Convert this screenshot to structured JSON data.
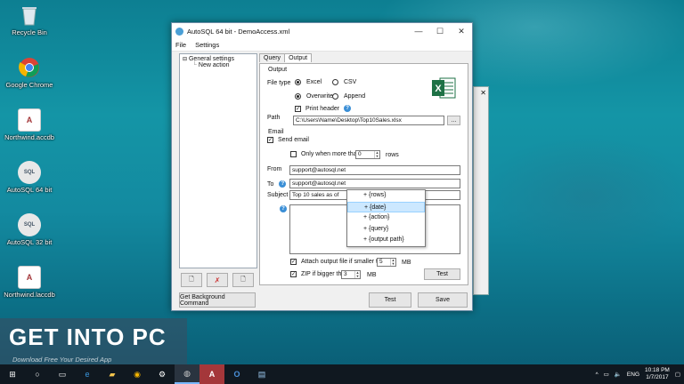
{
  "desktop": {
    "icons": [
      {
        "label": "Recycle Bin",
        "icon": "recycle-bin-icon"
      },
      {
        "label": "Google Chrome",
        "icon": "chrome-icon"
      },
      {
        "label": "Northwind.accdb",
        "icon": "access-file-icon"
      },
      {
        "label": "AutoSQL 64 bit",
        "icon": "autosql-icon"
      },
      {
        "label": "AutoSQL 32 bit",
        "icon": "autosql-icon"
      },
      {
        "label": "Northwind.laccdb",
        "icon": "access-lock-file-icon"
      }
    ]
  },
  "window": {
    "title": "AutoSQL 64 bit - DemoAccess.xml",
    "menu": [
      "File",
      "Settings"
    ],
    "tree": {
      "root": "General settings",
      "child": "New action"
    },
    "tabs": [
      "Query",
      "Output"
    ],
    "active_tab": "Output",
    "output": {
      "section_label": "Output",
      "file_type_label": "File type",
      "file_type_options": [
        "Excel",
        "CSV"
      ],
      "file_type_selected": "Excel",
      "write_mode_options": [
        "Overwrite",
        "Append"
      ],
      "write_mode_selected": "Overwrite",
      "print_header_label": "Print header",
      "print_header_checked": true,
      "path_label": "Path",
      "path_value": "C:\\Users\\Name\\Desktop\\Top10Sales.xlsx",
      "browse_label": "..."
    },
    "email": {
      "section_label": "Email",
      "send_email_label": "Send email",
      "send_email_checked": true,
      "only_when_label": "Only when more than",
      "only_when_checked": false,
      "only_when_value": "0",
      "rows_label": "rows",
      "from_label": "From",
      "from_value": "support@autosql.net",
      "to_label": "To",
      "to_value": "support@autosql.net",
      "subject_label": "Subject",
      "subject_value": "Top 10 sales as of",
      "body_value": "",
      "attach_label": "Attach output file if smaller than",
      "attach_checked": true,
      "attach_value": "5",
      "attach_unit": "MB",
      "zip_label": "ZIP if bigger than",
      "zip_checked": true,
      "zip_value": "3",
      "zip_unit": "MB",
      "test_label": "Test"
    },
    "dropdown": {
      "items": [
        "+ {rows}",
        "+ {date}",
        "+ {action}",
        "+ {query}",
        "+ {output path}"
      ],
      "selected": "+ {date}"
    },
    "footer": {
      "get_background_label": "Get Background Command",
      "test_label": "Test",
      "save_label": "Save"
    }
  },
  "watermark": {
    "brand": "GET INTO PC",
    "tagline": "Download Free Your Desired App"
  },
  "taskbar": {
    "apps": [
      "windows-start-icon",
      "search-icon",
      "task-view-icon",
      "edge-icon",
      "file-explorer-icon",
      "chrome-icon",
      "settings-icon",
      "autosql-icon",
      "access-icon",
      "outlook-icon",
      "notepad-icon"
    ],
    "language": "ENG",
    "time": "10:18 PM",
    "date": "1/7/2017"
  }
}
